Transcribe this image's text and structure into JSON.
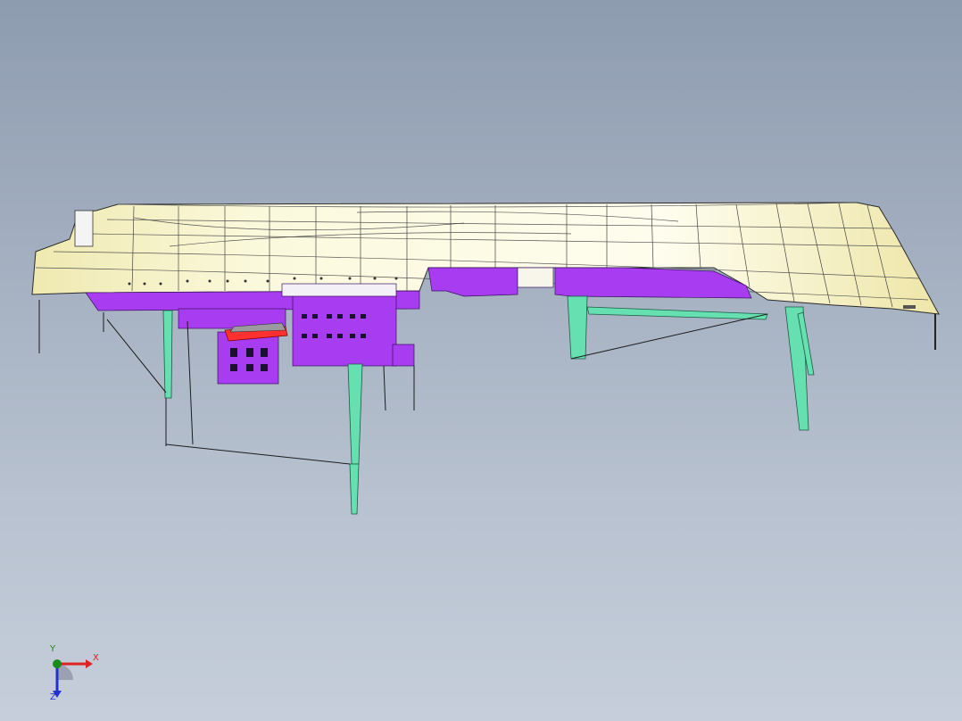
{
  "viewport": {
    "background_top": "#8e9cb0",
    "background_bottom": "#c6cedb"
  },
  "model": {
    "hull_color": "#fdfce8",
    "hull_edge_color": "#2a2a2a",
    "superstructure_color": "#a83cf0",
    "crane_color": "#66e0b0",
    "boom_color": "#ff3030"
  },
  "triad": {
    "x_label": "X",
    "y_label": "Y",
    "z_label": "Z",
    "x_color": "#d22",
    "y_color": "#1a8a1a",
    "z_color": "#2233cc"
  }
}
